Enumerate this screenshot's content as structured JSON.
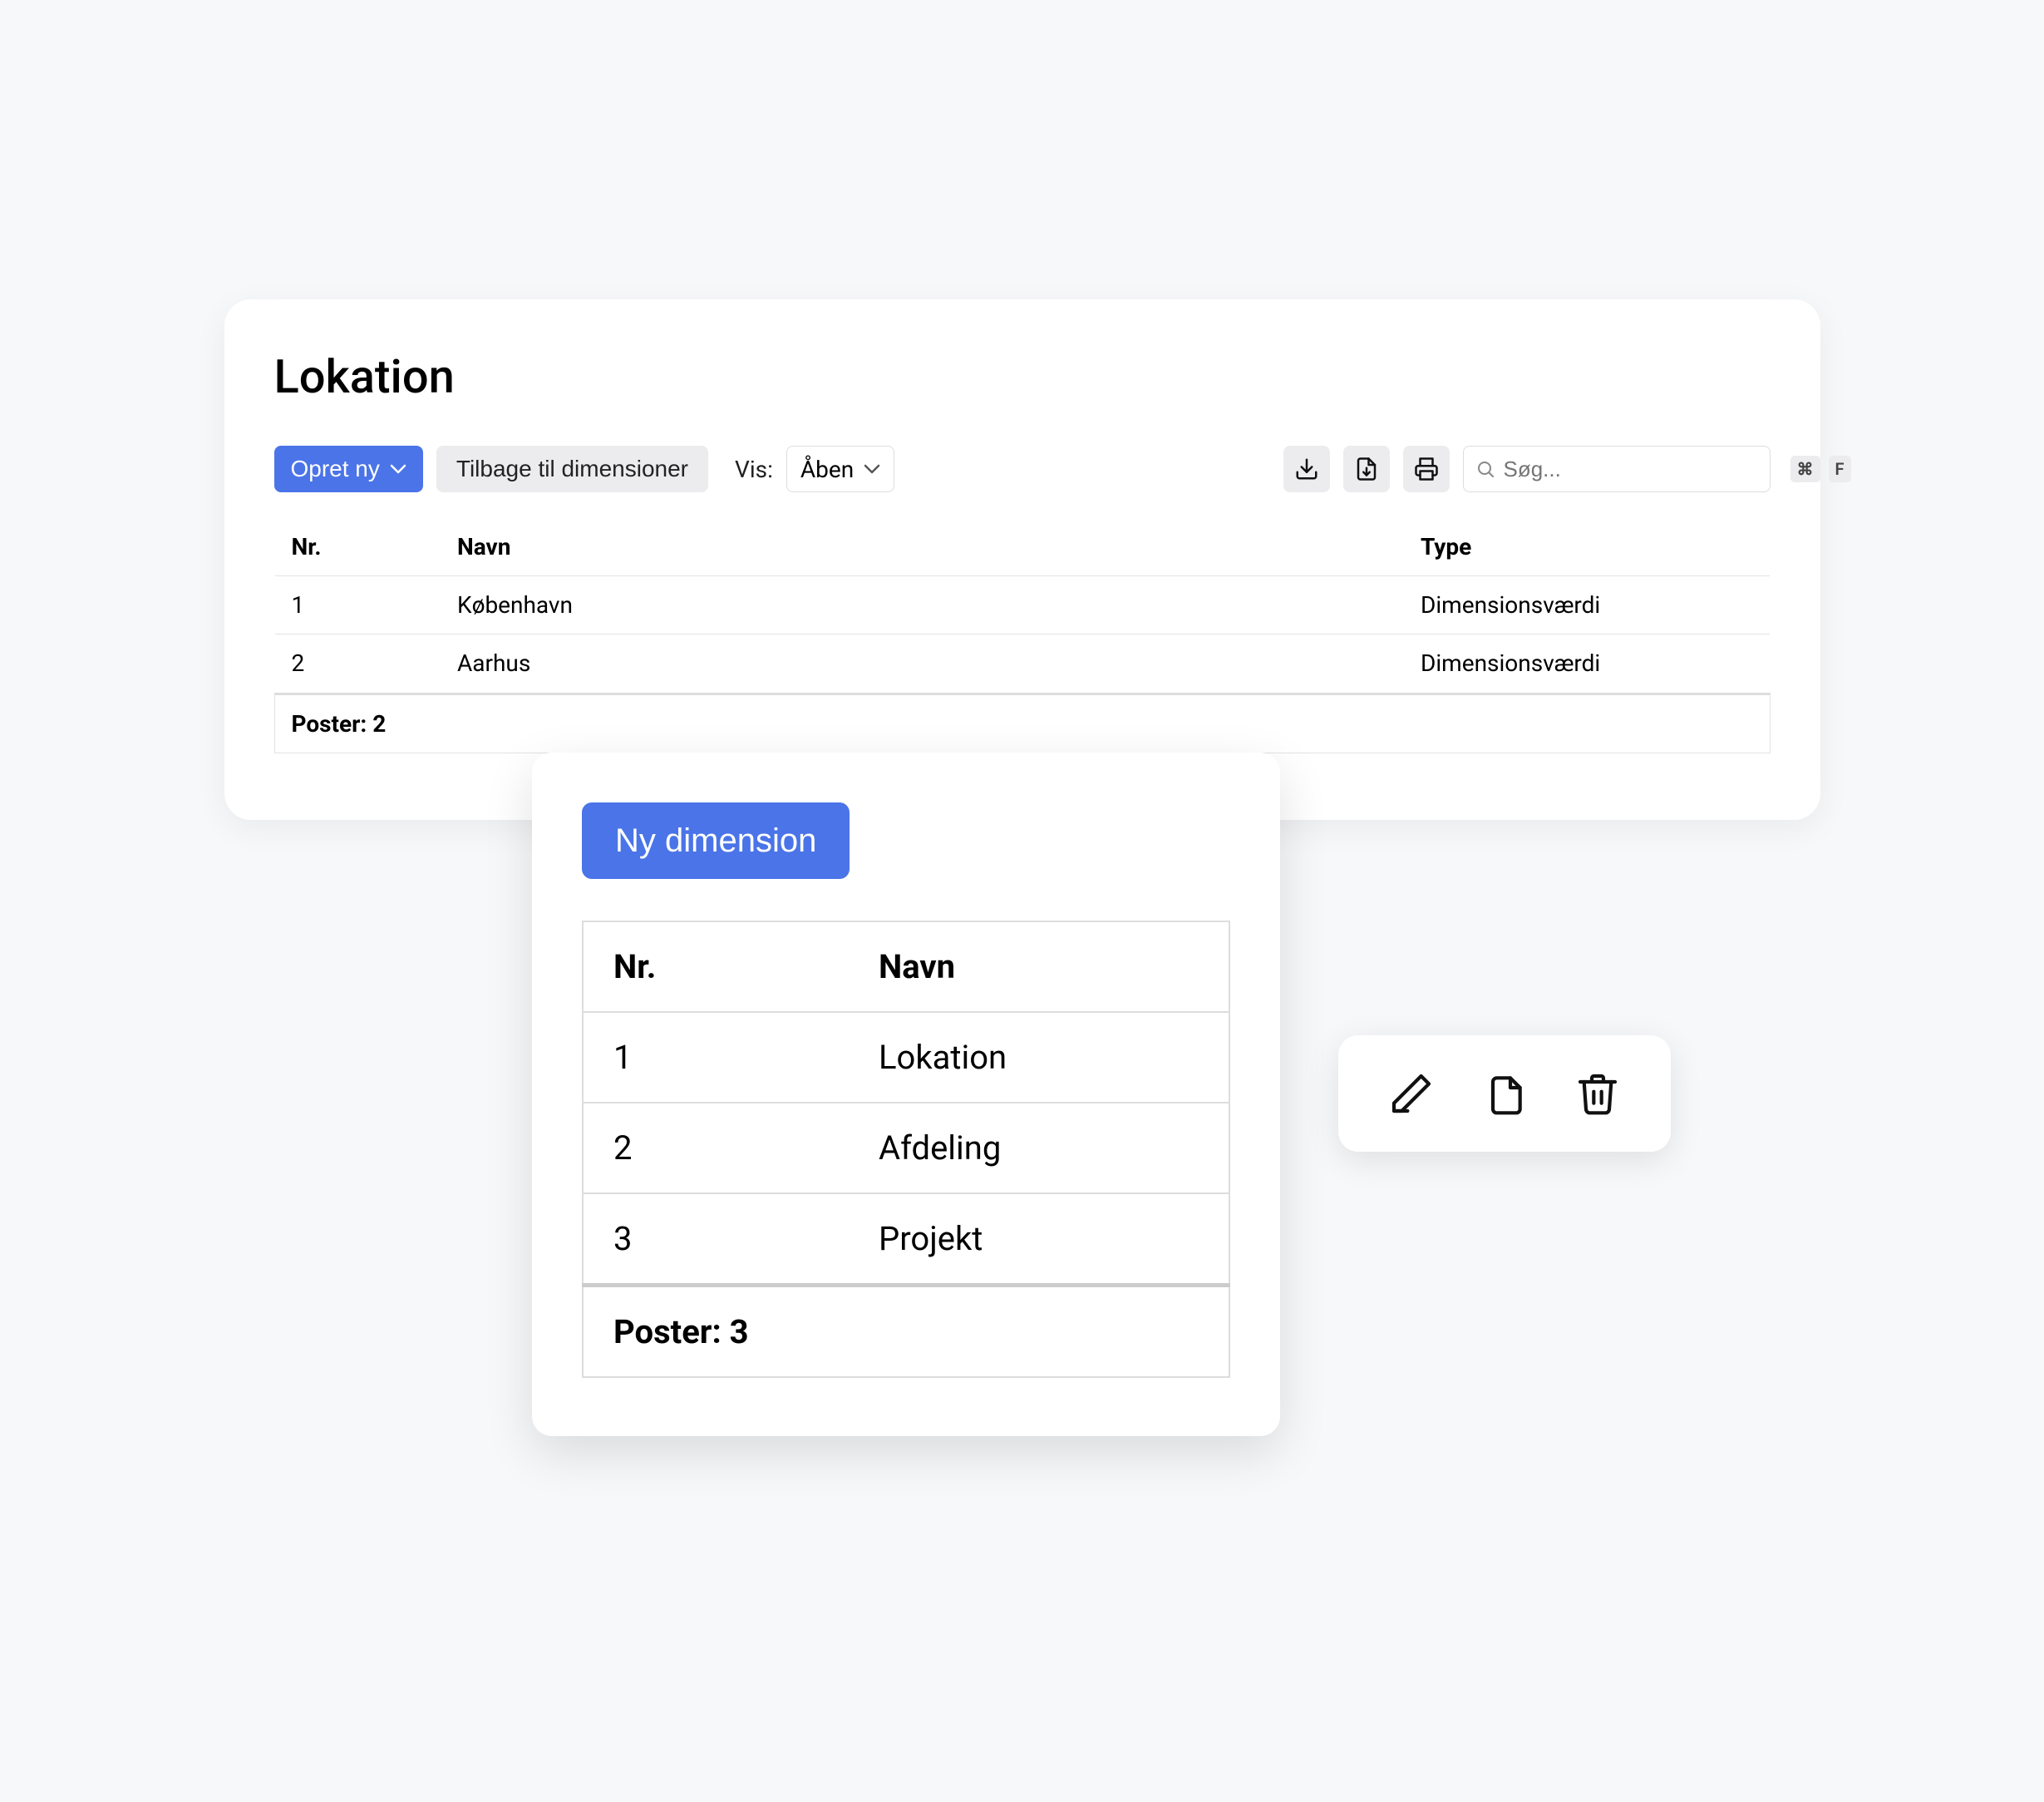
{
  "page": {
    "title": "Lokation"
  },
  "toolbar": {
    "create_label": "Opret ny",
    "back_label": "Tilbage til dimensioner",
    "filter_prefix": "Vis:",
    "filter_value": "Åben"
  },
  "search": {
    "placeholder": "Søg...",
    "kbd1": "⌘",
    "kbd2": "F"
  },
  "table": {
    "headers": {
      "nr": "Nr.",
      "name": "Navn",
      "type": "Type"
    },
    "rows": [
      {
        "nr": "1",
        "name": "København",
        "type": "Dimensionsværdi"
      },
      {
        "nr": "2",
        "name": "Aarhus",
        "type": "Dimensionsværdi"
      }
    ],
    "footer": "Poster: 2"
  },
  "popup": {
    "button_label": "Ny dimension",
    "headers": {
      "nr": "Nr.",
      "name": "Navn"
    },
    "rows": [
      {
        "nr": "1",
        "name": "Lokation"
      },
      {
        "nr": "2",
        "name": "Afdeling"
      },
      {
        "nr": "3",
        "name": "Projekt"
      }
    ],
    "footer": "Poster: 3"
  },
  "colors": {
    "primary": "#4a74e8"
  }
}
